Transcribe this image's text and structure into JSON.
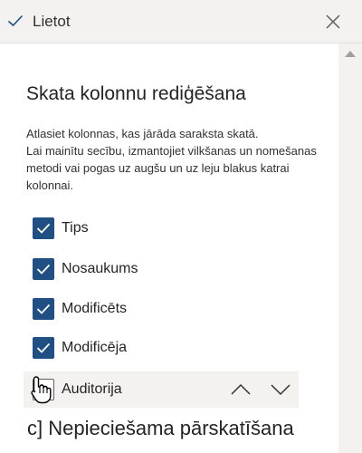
{
  "header": {
    "apply_label": "Lietot"
  },
  "panel": {
    "title": "Skata kolonnu rediģēšana",
    "description_lines": [
      "Atlasiet kolonnas, kas jārāda saraksta skatā.",
      "Lai mainītu secību, izmantojiet vilkšanas un nomešanas",
      "metodi vai pogas uz augšu un uz leju blakus katrai",
      "kolonnai."
    ],
    "columns": [
      {
        "label": "Tips",
        "checked": true
      },
      {
        "label": "Nosaukums",
        "checked": true
      },
      {
        "label": "Modificēts",
        "checked": true
      },
      {
        "label": "Modificēja",
        "checked": true
      },
      {
        "label": "Auditorija",
        "checked": false
      }
    ]
  },
  "caption": "c] Nepieciešama pārskatīšana",
  "colors": {
    "accent": "#1f4f83",
    "hover_row": "#f3f2f1",
    "topbar": "#f3f2f1"
  }
}
